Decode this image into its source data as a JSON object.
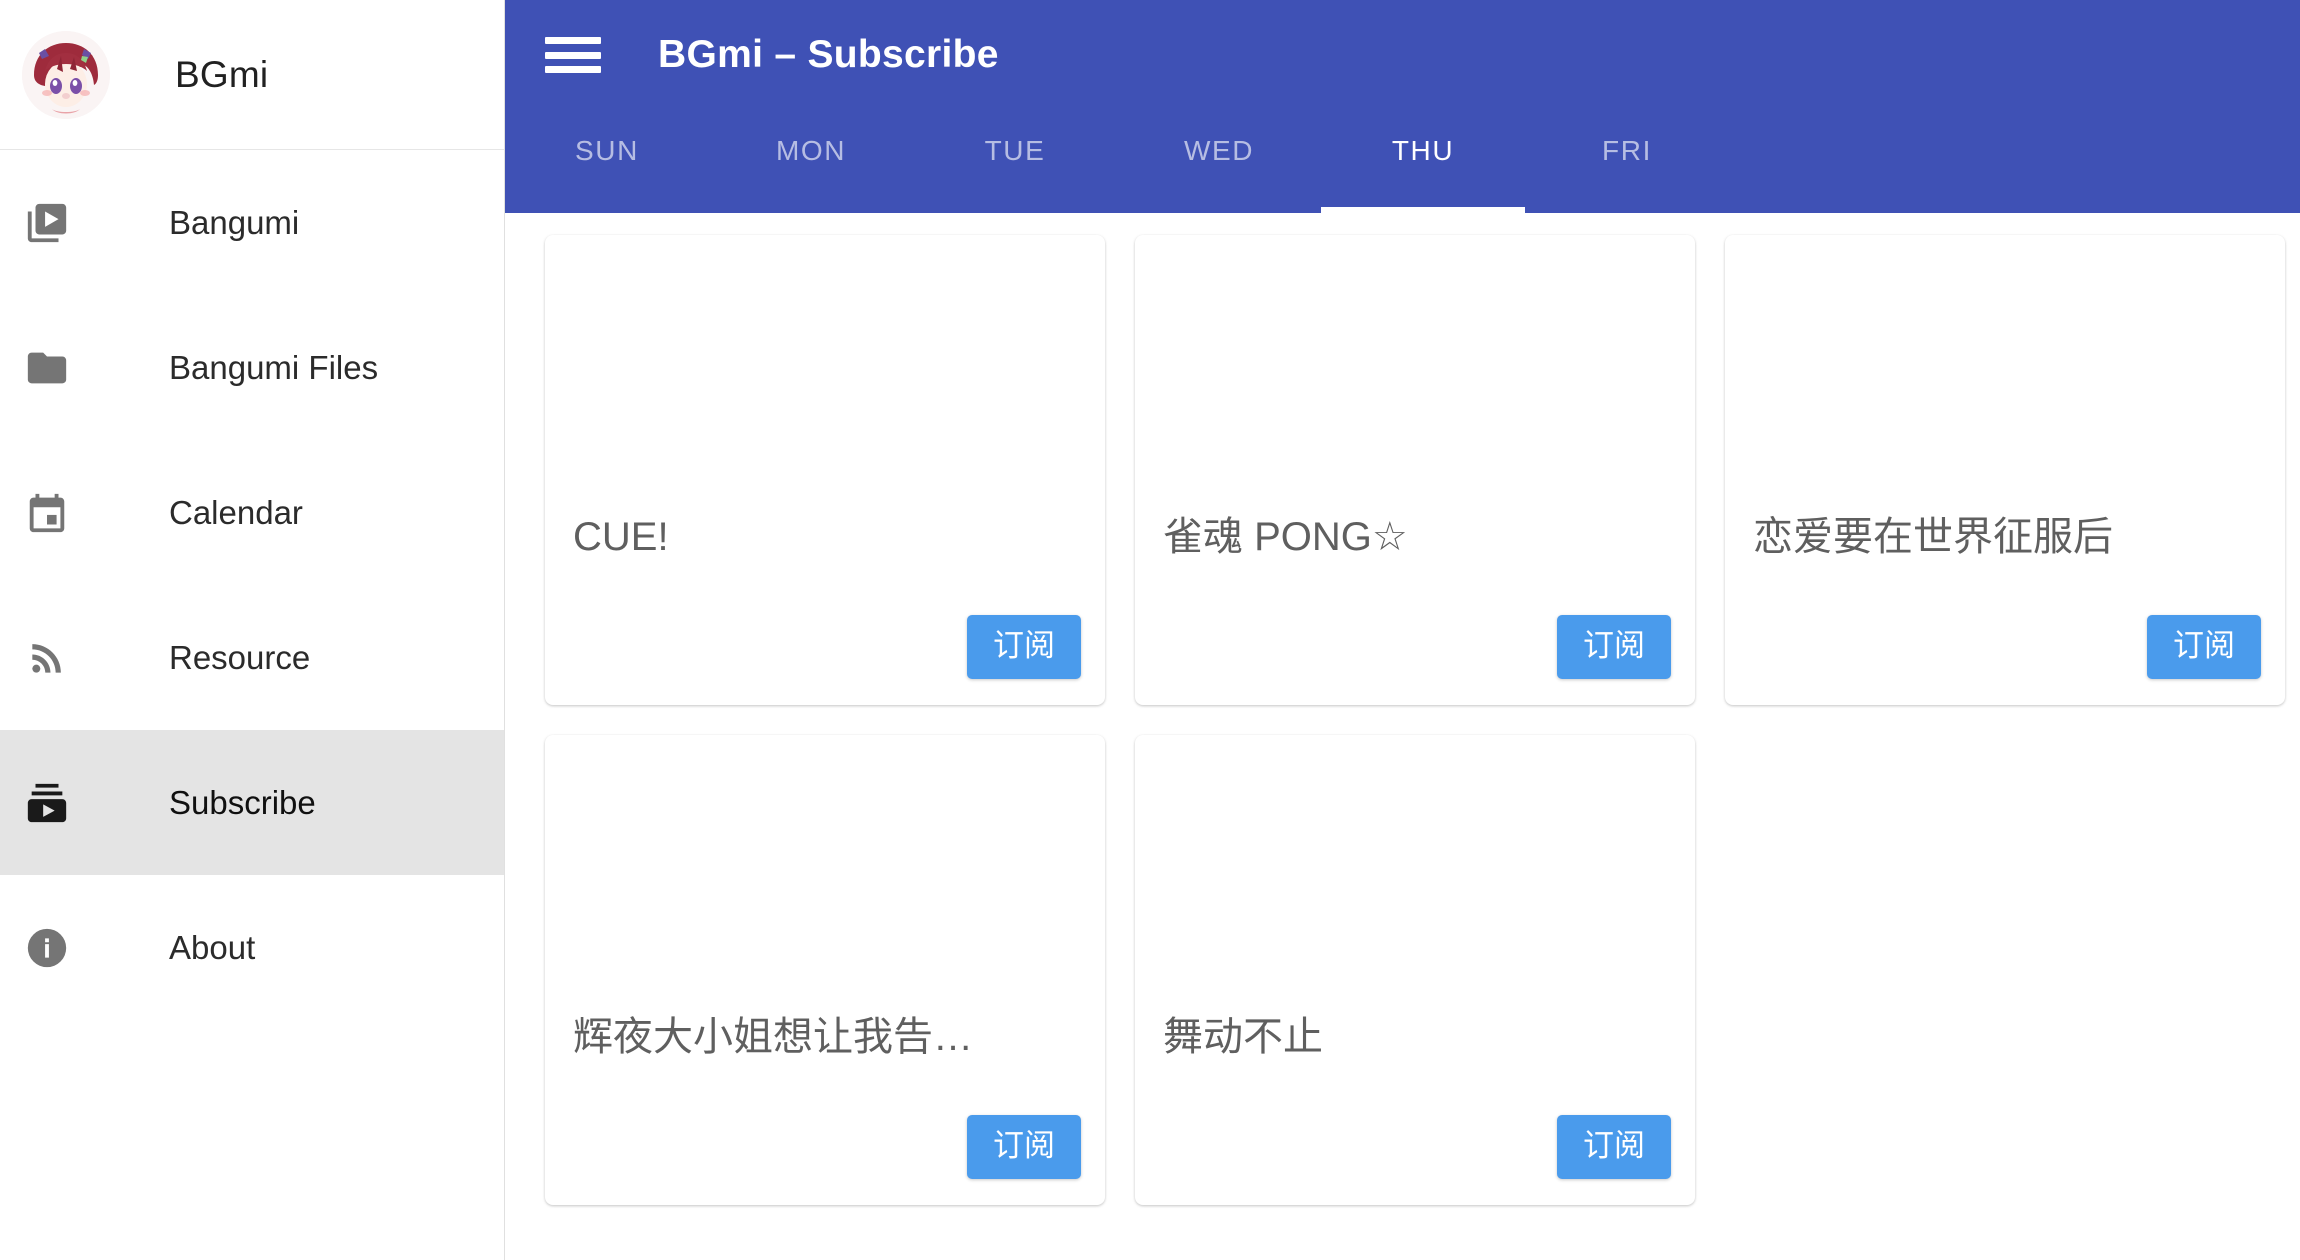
{
  "sidebar": {
    "brand": {
      "name": "BGmi",
      "avatar_icon": "anime-girl-avatar"
    },
    "items": [
      {
        "label": "Bangumi",
        "icon": "video-library-icon",
        "active": false
      },
      {
        "label": "Bangumi Files",
        "icon": "folder-icon",
        "active": false
      },
      {
        "label": "Calendar",
        "icon": "calendar-icon",
        "active": false
      },
      {
        "label": "Resource",
        "icon": "rss-feed-icon",
        "active": false
      },
      {
        "label": "Subscribe",
        "icon": "subscriptions-icon",
        "active": true
      },
      {
        "label": "About",
        "icon": "info-circle-icon",
        "active": false
      }
    ]
  },
  "header": {
    "menu_icon": "hamburger-menu-icon",
    "title": "BGmi – Subscribe",
    "background_color": "#3f51b5"
  },
  "tabs": {
    "items": [
      {
        "label": "SUN",
        "active": false
      },
      {
        "label": "MON",
        "active": false
      },
      {
        "label": "TUE",
        "active": false
      },
      {
        "label": "WED",
        "active": false
      },
      {
        "label": "THU",
        "active": true
      },
      {
        "label": "FRI",
        "active": false
      }
    ],
    "active_label": "THU",
    "indicator_color": "#ffffff"
  },
  "main": {
    "subscribe_label": "订阅",
    "button_color": "#4a9bec",
    "cards": [
      {
        "title": "CUE!"
      },
      {
        "title": "雀魂 PONG☆"
      },
      {
        "title": "恋爱要在世界征服后"
      },
      {
        "title": "辉夜大小姐想让我告…"
      },
      {
        "title": "舞动不止"
      }
    ]
  }
}
